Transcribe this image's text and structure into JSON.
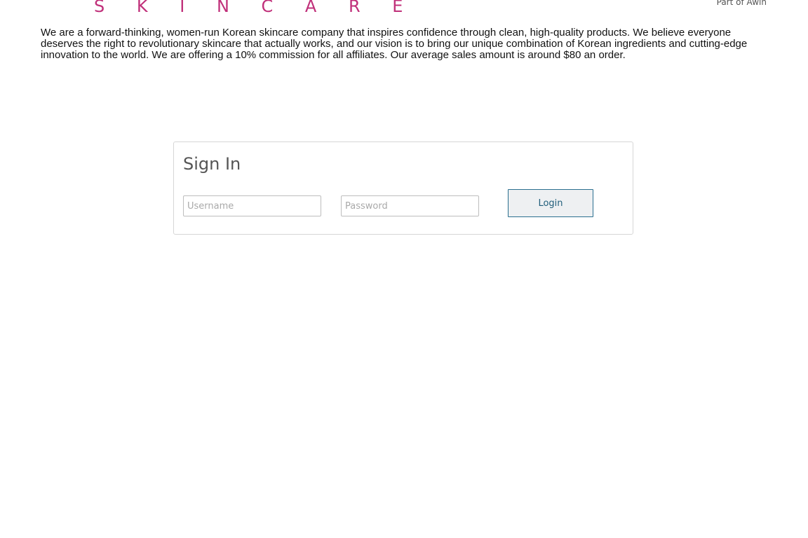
{
  "header": {
    "brand_text": "S K I N C A R E",
    "network_link": "Part of Awin"
  },
  "intro": {
    "text": "We are a forward-thinking, women-run Korean skincare company that inspires confidence through clean, high-quality products. We believe everyone deserves the right to revolutionary skincare that actually works, and our vision is to bring our unique combination of Korean ingredients and cutting-edge innovation to the world. We are offering a 10% commission for all affiliates. Our average sales amount is around $80 an order."
  },
  "signin": {
    "title": "Sign In",
    "username_placeholder": "Username",
    "username_value": "",
    "password_placeholder": "Password",
    "password_value": "",
    "login_label": "Login"
  },
  "colors": {
    "brand": "#c0307a",
    "button_border": "#2a6f8f",
    "button_text": "#1f5d7a",
    "panel_border": "#d6d6d6"
  }
}
